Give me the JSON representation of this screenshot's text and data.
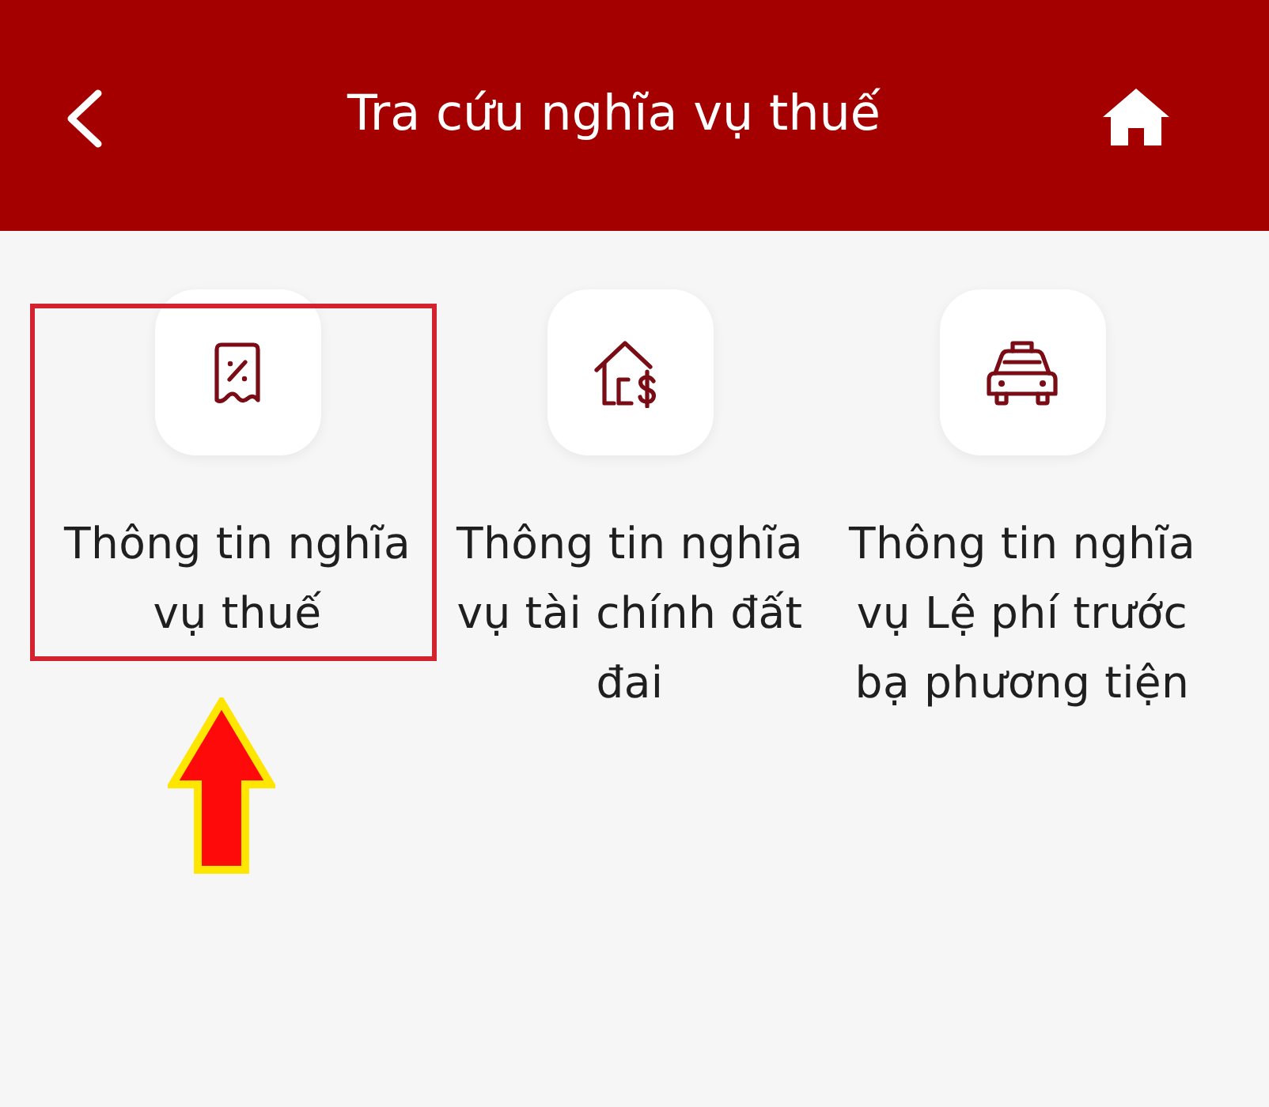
{
  "header": {
    "title": "Tra cứu nghĩa vụ thuế"
  },
  "items": [
    {
      "kind": "receipt",
      "label": "Thông tin nghĩa vụ thuế",
      "highlighted": true
    },
    {
      "kind": "house",
      "label": "Thông tin nghĩa vụ tài chính đất đai",
      "highlighted": false
    },
    {
      "kind": "taxi",
      "label": "Thông tin nghĩa vụ Lệ phí trước bạ phương tiện",
      "highlighted": false
    }
  ]
}
